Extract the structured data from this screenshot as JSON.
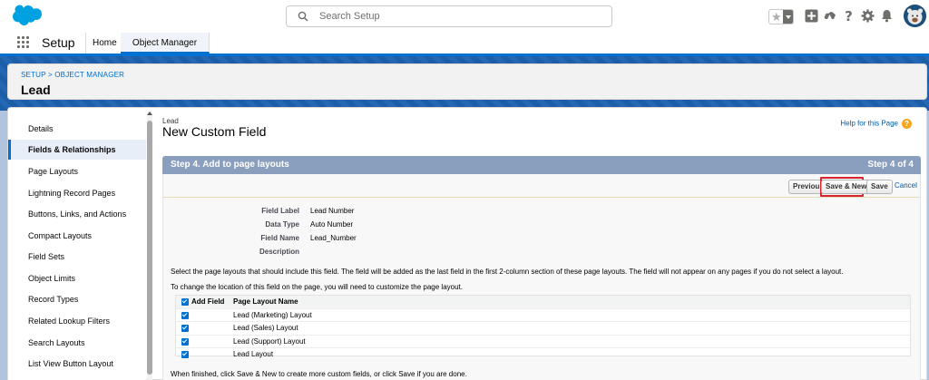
{
  "header": {
    "search_placeholder": "Search Setup",
    "icons": [
      "favorites-star-icon",
      "global-add-icon",
      "trailhead-icon",
      "help-icon",
      "setup-gear-icon",
      "notification-bell-icon",
      "avatar"
    ]
  },
  "nav": {
    "app_name": "Setup",
    "tabs": [
      {
        "label": "Home"
      },
      {
        "label": "Object Manager"
      }
    ]
  },
  "breadcrumb": {
    "path": "SETUP > OBJECT MANAGER",
    "object": "Lead"
  },
  "sidebar": {
    "items": [
      {
        "label": "Details"
      },
      {
        "label": "Fields & Relationships",
        "active": true
      },
      {
        "label": "Page Layouts"
      },
      {
        "label": "Lightning Record Pages"
      },
      {
        "label": "Buttons, Links, and Actions"
      },
      {
        "label": "Compact Layouts"
      },
      {
        "label": "Field Sets"
      },
      {
        "label": "Object Limits"
      },
      {
        "label": "Record Types"
      },
      {
        "label": "Related Lookup Filters"
      },
      {
        "label": "Search Layouts"
      },
      {
        "label": "List View Button Layout"
      }
    ]
  },
  "page": {
    "object_label": "Lead",
    "title": "New Custom Field",
    "help_link": "Help for this Page",
    "step_title": "Step 4. Add to page layouts",
    "step_number": "Step 4 of 4"
  },
  "buttons": {
    "previous": "Previous",
    "save_new": "Save & New",
    "save": "Save",
    "cancel": "Cancel"
  },
  "field_info": {
    "field_label_lbl": "Field Label",
    "field_label_val": "Lead Number",
    "data_type_lbl": "Data Type",
    "data_type_val": "Auto Number",
    "field_name_lbl": "Field Name",
    "field_name_val": "Lead_Number",
    "description_lbl": "Description",
    "description_val": ""
  },
  "instructions": {
    "line1": "Select the page layouts that should include this field. The field will be added as the last field in the first 2-column section of these page layouts. The field will not appear on any pages if you do not select a layout.",
    "line2": "To change the location of this field on the page, you will need to customize the page layout.",
    "footer": "When finished, click Save & New to create more custom fields, or click Save if you are done."
  },
  "layout_table": {
    "col_add": "Add Field",
    "col_name": "Page Layout Name",
    "rows": [
      {
        "name": "Lead (Marketing) Layout",
        "checked": true
      },
      {
        "name": "Lead (Sales) Layout",
        "checked": true
      },
      {
        "name": "Lead (Support) Layout",
        "checked": true
      },
      {
        "name": "Lead Layout",
        "checked": true
      }
    ]
  },
  "colors": {
    "brand": "#0070d2",
    "step_bar": "#8a9ebe",
    "highlight": "#d8242f"
  }
}
